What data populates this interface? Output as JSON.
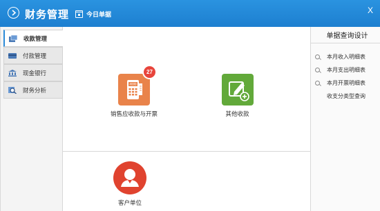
{
  "header": {
    "app_title": "财务管理",
    "today_label": "今日单据",
    "close_label": "X"
  },
  "sidebar": {
    "items": [
      {
        "label": "收款管理",
        "icon": "receipt-icon",
        "active": true
      },
      {
        "label": "付款管理",
        "icon": "payment-icon",
        "active": false
      },
      {
        "label": "现金银行",
        "icon": "bank-icon",
        "active": false
      },
      {
        "label": "财务分析",
        "icon": "analysis-icon",
        "active": false
      }
    ]
  },
  "main": {
    "tiles": [
      {
        "label": "销售应收款与开票",
        "icon": "pos-terminal-icon",
        "color": "#e9834a",
        "badge": "27"
      },
      {
        "label": "其他收款",
        "icon": "edit-add-icon",
        "color": "#62a93a"
      },
      {
        "label": "客户单位",
        "icon": "customer-icon",
        "color": "#e0432f"
      }
    ]
  },
  "right_panel": {
    "title": "单据查询设计",
    "items": [
      {
        "label": "本月收入明细表",
        "icon": "search-icon"
      },
      {
        "label": "本月支出明细表",
        "icon": "search-icon"
      },
      {
        "label": "本月开票明细表",
        "icon": "search-icon"
      },
      {
        "label": "收支分类型查询",
        "icon": null
      }
    ]
  },
  "colors": {
    "header_blue": "#1d7fd0",
    "accent": "#2a8ad8",
    "badge_red": "#e8453c"
  }
}
